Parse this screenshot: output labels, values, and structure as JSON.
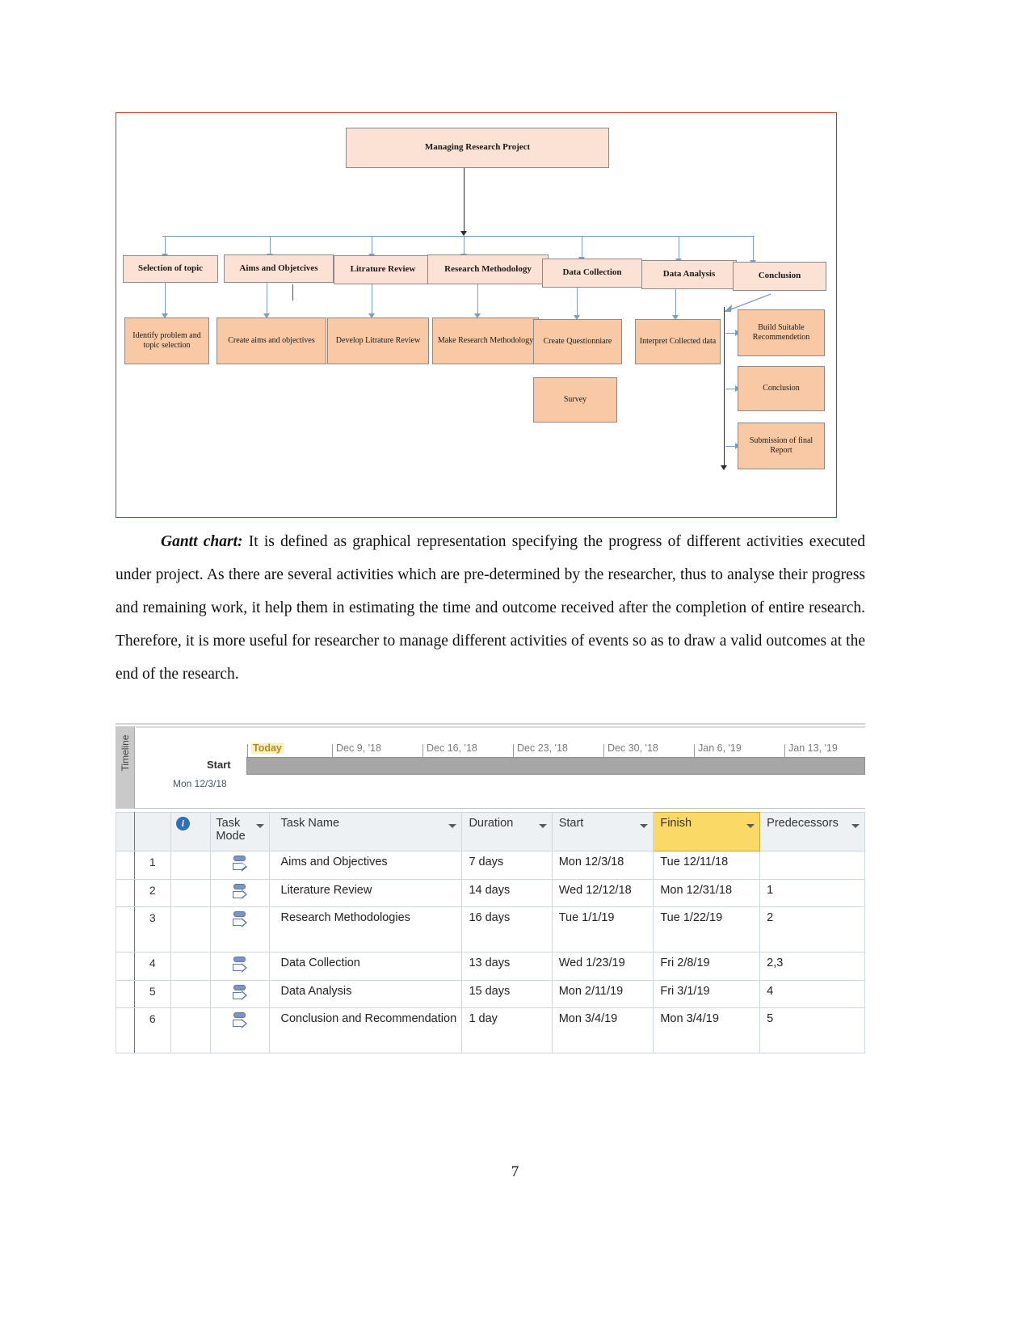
{
  "diagram": {
    "title_node": "Managing Research Project",
    "level1": [
      "Selection of topic",
      "Aims and Objetcives",
      "Litrature Review",
      "Research Methodology",
      "Data Collection",
      "Data Analysis",
      "Conclusion"
    ],
    "level2": [
      "Identify problem and topic selection",
      "Create aims and objectives",
      "Develop Litrature Review",
      "Make Research Methodology",
      "Create Questionniare",
      "Interpret Collected data"
    ],
    "survey_node": "Survey",
    "conclusion_branch": [
      "Build Suitable Recommendetion",
      "Conclusion",
      "Submission of final Report"
    ],
    "border_color": "#c0392b",
    "node_fill_light": "#fbe0d0",
    "node_fill_dark": "#f8c9a4"
  },
  "paragraph": {
    "lead": "Gantt chart:",
    "text": " It is defined as graphical representation specifying the progress of different activities executed under project. As there are several activities which are pre-determined by the researcher, thus to analyse their progress and remaining work, it help them in estimating the time and outcome received after the completion of entire research. Therefore, it is more useful for researcher to manage different activities of events so as to draw a valid outcomes at the end of the research."
  },
  "gantt": {
    "timeline_tab_label": "Timeline",
    "today_label": "Today",
    "start_label": "Start",
    "start_date": "Mon 12/3/18",
    "timeline_ticks": [
      "Dec 9, '18",
      "Dec 16, '18",
      "Dec 23, '18",
      "Dec 30, '18",
      "Jan 6, '19",
      "Jan 13, '19"
    ],
    "columns": [
      "Task Mode",
      "Task Name",
      "Duration",
      "Start",
      "Finish",
      "Predecessors"
    ],
    "finish_column_highlight": "#fbd966",
    "rows": [
      {
        "id": "1",
        "name": "Aims and Objectives",
        "duration": "7 days",
        "start": "Mon 12/3/18",
        "finish": "Tue 12/11/18",
        "predecessors": ""
      },
      {
        "id": "2",
        "name": "Literature Review",
        "duration": "14 days",
        "start": "Wed 12/12/18",
        "finish": "Mon 12/31/18",
        "predecessors": "1"
      },
      {
        "id": "3",
        "name": "Research Methodologies",
        "duration": "16 days",
        "start": "Tue 1/1/19",
        "finish": "Tue 1/22/19",
        "predecessors": "2"
      },
      {
        "id": "4",
        "name": "Data Collection",
        "duration": "13 days",
        "start": "Wed 1/23/19",
        "finish": "Fri 2/8/19",
        "predecessors": "2,3"
      },
      {
        "id": "5",
        "name": "Data Analysis",
        "duration": "15 days",
        "start": "Mon 2/11/19",
        "finish": "Fri 3/1/19",
        "predecessors": "4"
      },
      {
        "id": "6",
        "name": "Conclusion and Recommendation",
        "duration": "1 day",
        "start": "Mon 3/4/19",
        "finish": "Mon 3/4/19",
        "predecessors": "5"
      }
    ]
  },
  "footer": {
    "page_number": "7"
  },
  "chart_data": {
    "type": "table",
    "title": "Gantt chart task schedule",
    "categories": [
      "Aims and Objectives",
      "Literature Review",
      "Research Methodologies",
      "Data Collection",
      "Data Analysis",
      "Conclusion and Recommendation"
    ],
    "series": [
      {
        "name": "Duration (days)",
        "values": [
          7,
          14,
          16,
          13,
          15,
          1
        ]
      }
    ],
    "start_dates": [
      "Mon 12/3/18",
      "Wed 12/12/18",
      "Tue 1/1/19",
      "Wed 1/23/19",
      "Mon 2/11/19",
      "Mon 3/4/19"
    ],
    "finish_dates": [
      "Tue 12/11/18",
      "Mon 12/31/18",
      "Tue 1/22/19",
      "Fri 2/8/19",
      "Fri 3/1/19",
      "Mon 3/4/19"
    ],
    "predecessors": [
      "",
      "1",
      "2",
      "2,3",
      "4",
      "5"
    ],
    "xlabel": "Timeline",
    "ylabel": "Task",
    "axis_ticks": [
      "Dec 9, '18",
      "Dec 16, '18",
      "Dec 23, '18",
      "Dec 30, '18",
      "Jan 6, '19",
      "Jan 13, '19"
    ],
    "project_start": "Mon 12/3/18",
    "grid": false,
    "legend": "none"
  }
}
